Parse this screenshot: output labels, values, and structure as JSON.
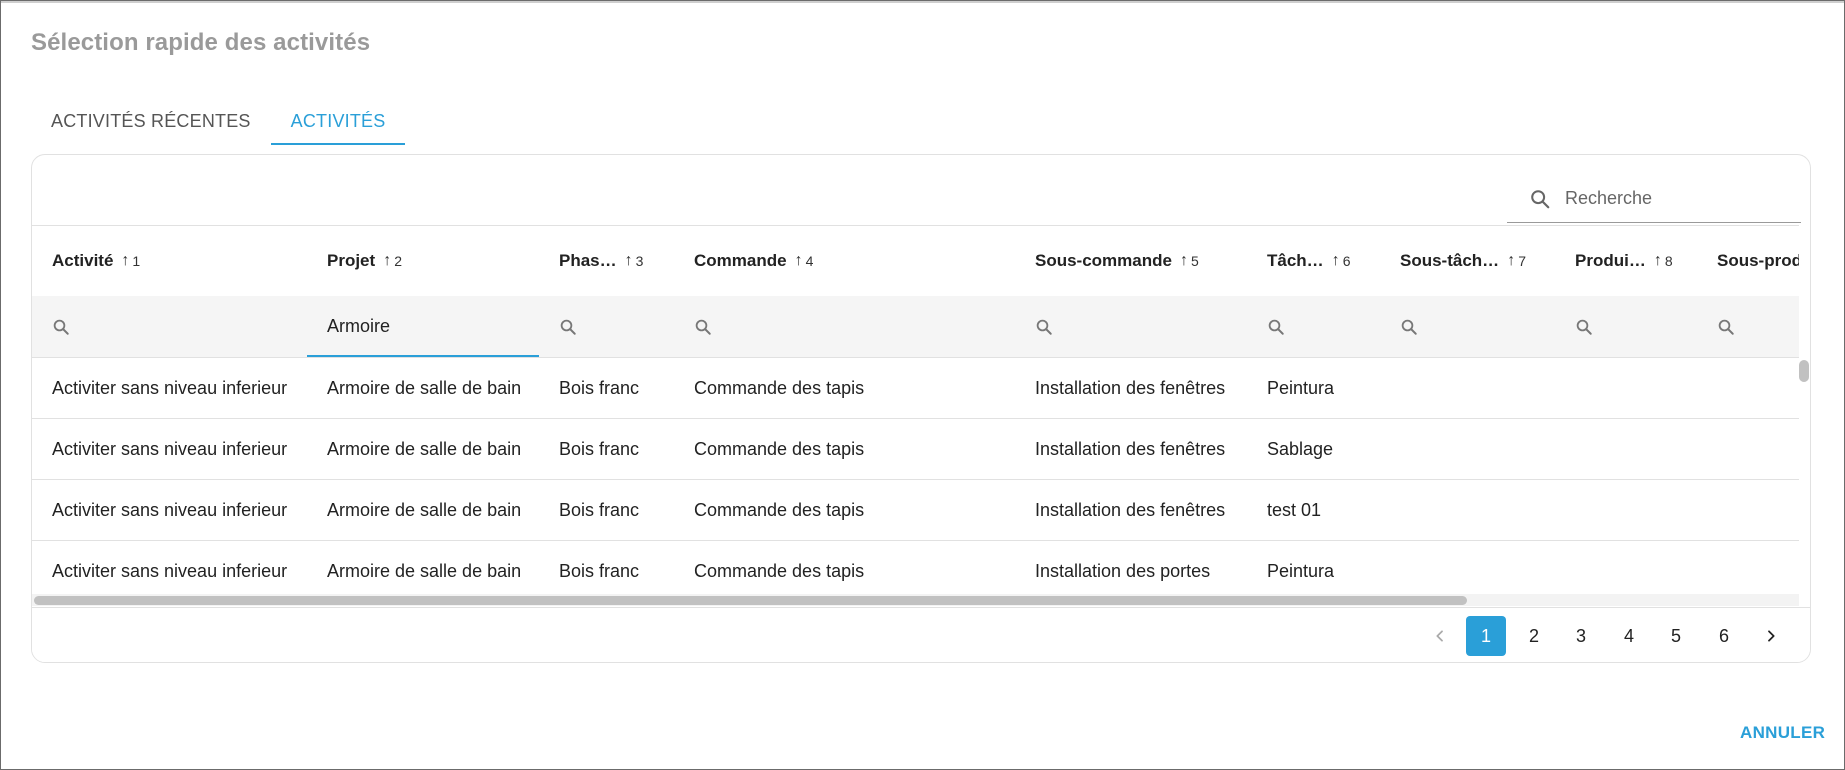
{
  "dialog": {
    "title": "Sélection rapide des activités",
    "tabs": [
      {
        "label": "ACTIVITÉS RÉCENTES",
        "active": false
      },
      {
        "label": "ACTIVITÉS",
        "active": true
      }
    ],
    "search": {
      "placeholder": "Recherche",
      "icon": "search-icon"
    },
    "columns": [
      {
        "label": "Activité",
        "sort": "1"
      },
      {
        "label": "Projet",
        "sort": "2"
      },
      {
        "label": "Phas…",
        "sort": "3"
      },
      {
        "label": "Commande",
        "sort": "4"
      },
      {
        "label": "Sous-commande",
        "sort": "5"
      },
      {
        "label": "Tâch…",
        "sort": "6"
      },
      {
        "label": "Sous-tâch…",
        "sort": "7"
      },
      {
        "label": "Produi…",
        "sort": "8"
      },
      {
        "label": "Sous-prod",
        "sort": ""
      }
    ],
    "sort_arrow": "↑",
    "filters": [
      "",
      "Armoire",
      "",
      "",
      "",
      "",
      "",
      "",
      ""
    ],
    "rows": [
      [
        "Activiter sans niveau inferieur",
        "Armoire de salle de bain",
        "Bois franc",
        "Commande des tapis",
        "Installation des fenêtres",
        "Peintura",
        "",
        "",
        ""
      ],
      [
        "Activiter sans niveau inferieur",
        "Armoire de salle de bain",
        "Bois franc",
        "Commande des tapis",
        "Installation des fenêtres",
        "Sablage",
        "",
        "",
        ""
      ],
      [
        "Activiter sans niveau inferieur",
        "Armoire de salle de bain",
        "Bois franc",
        "Commande des tapis",
        "Installation des fenêtres",
        "test 01",
        "",
        "",
        ""
      ],
      [
        "Activiter sans niveau inferieur",
        "Armoire de salle de bain",
        "Bois franc",
        "Commande des tapis",
        "Installation des portes",
        "Peintura",
        "",
        "",
        ""
      ]
    ],
    "pagination": {
      "pages": [
        "1",
        "2",
        "3",
        "4",
        "5",
        "6"
      ],
      "current_page": "1",
      "prev_icon": "chevron-left-icon",
      "next_icon": "chevron-right-icon"
    },
    "cancel_label": "ANNULER",
    "accent_color": "#2a9fd8"
  }
}
